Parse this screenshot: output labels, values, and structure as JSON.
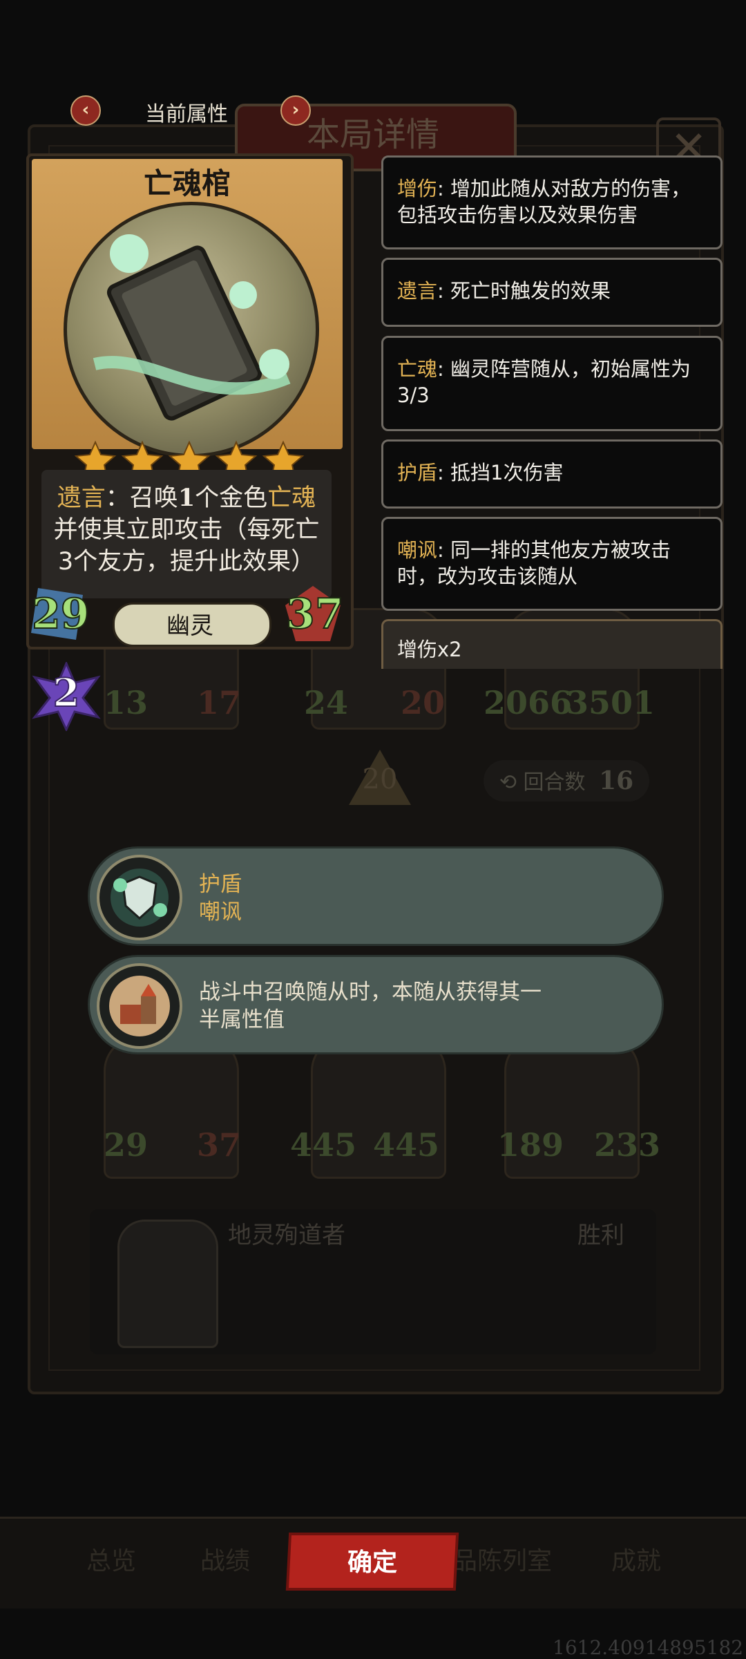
{
  "header": {
    "prev_icon": "chevron-left-icon",
    "title": "当前属性",
    "next_icon": "chevron-right-icon"
  },
  "background": {
    "panel_title": "本局详情",
    "close_icon": "close-icon",
    "row1_stats": [
      "13",
      "17",
      "24",
      "20",
      "2066",
      "3501"
    ],
    "wave_number": "20",
    "round_label": "回合数",
    "round_value": "16",
    "row2_stats": [
      "29",
      "37",
      "445",
      "445",
      "189",
      "233"
    ],
    "opponent_name": "地灵殉道者",
    "result": "胜利",
    "tabs": [
      "总览",
      "战绩",
      "品陈列室",
      "成就"
    ],
    "coords": "1612.40914895182"
  },
  "card": {
    "name": "亡魂棺",
    "stars": 5,
    "text_line1_a": "遗言",
    "text_line1_b": "：召唤",
    "text_line1_c": "1",
    "text_line1_d": "个金色",
    "text_line1_e": "亡魂",
    "text_line2": "并使其立即攻击（每死亡",
    "text_line3": "3个友方，提升此效果）",
    "attack": "29",
    "health": "37",
    "tribe": "幽灵",
    "tier": "2"
  },
  "keywords": [
    {
      "key": "增伤",
      "desc": ": 增加此随从对敌方的伤害，包括攻击伤害以及效果伤害"
    },
    {
      "key": "遗言",
      "desc": ": 死亡时触发的效果"
    },
    {
      "key": "亡魂",
      "desc": ": 幽灵阵营随从，初始属性为3/3"
    },
    {
      "key": "护盾",
      "desc": ": 抵挡1次伤害"
    },
    {
      "key": "嘲讽",
      "desc": ": 同一排的其他友方被攻击时，改为攻击该随从"
    }
  ],
  "keyword_partial": "增伤x2",
  "effects": [
    {
      "line1": "护盾",
      "line2": "嘲讽",
      "icon": "ghost-shield-icon"
    },
    {
      "line1": "战斗中召唤随从时，本随从获得其一",
      "line2": "半属性值",
      "icon": "castle-icon"
    }
  ],
  "confirm_label": "确定",
  "colors": {
    "keyword_gold": "#e3b354",
    "confirm_red": "#b3231d",
    "stat_green": "#a7e07b",
    "pill_bg": "#4b5a55"
  }
}
